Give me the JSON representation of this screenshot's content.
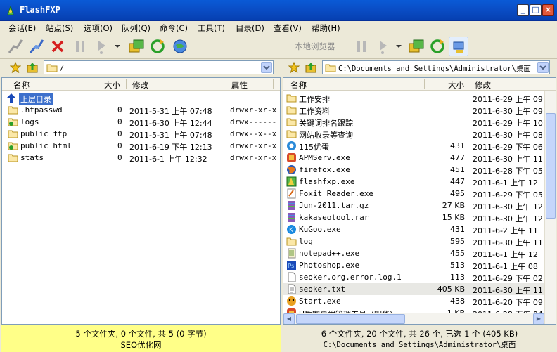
{
  "window": {
    "title": "FlashFXP",
    "min": "_",
    "max": "□",
    "close": "×"
  },
  "menu": [
    "会话(E)",
    "站点(S)",
    "选项(O)",
    "队列(Q)",
    "命令(C)",
    "工具(T)",
    "目录(D)",
    "查看(V)",
    "帮助(H)"
  ],
  "toolbar": {
    "local_browser_label": "本地浏览器"
  },
  "left": {
    "path": "/",
    "headers": {
      "name": "名称",
      "size": "大小",
      "modified": "修改",
      "attrs": "属性"
    },
    "up_label": "上层目录",
    "rows": [
      {
        "name": ".htpasswd",
        "size": "0",
        "date": "2011-5-31 上午 07:48",
        "attrs": "drwxr-xr-x",
        "icon": "folder"
      },
      {
        "name": "logs",
        "size": "0",
        "date": "2011-6-30 上午 12:44",
        "attrs": "drwx------",
        "icon": "folder-green"
      },
      {
        "name": "public_ftp",
        "size": "0",
        "date": "2011-5-31 上午 07:48",
        "attrs": "drwx--x--x",
        "icon": "folder"
      },
      {
        "name": "public_html",
        "size": "0",
        "date": "2011-6-19 下午 12:13",
        "attrs": "drwxr-xr-x",
        "icon": "folder-green"
      },
      {
        "name": "stats",
        "size": "0",
        "date": "2011-6-1 上午 12:32",
        "attrs": "drwxr-xr-x",
        "icon": "folder"
      }
    ],
    "status_line1": "5 个文件夹, 0 个文件, 共 5 (0 字节)",
    "status_line2": "SEO优化网"
  },
  "right": {
    "path": "C:\\Documents and Settings\\Administrator\\桌面",
    "headers": {
      "name": "名称",
      "size": "大小",
      "modified": "修改"
    },
    "rows": [
      {
        "name": "工作安排",
        "size": "",
        "date": "2011-6-29 上午 09",
        "icon": "folder"
      },
      {
        "name": "工作资料",
        "size": "",
        "date": "2011-6-30 上午 09",
        "icon": "folder"
      },
      {
        "name": "关键词排名跟踪",
        "size": "",
        "date": "2011-6-29 上午 10",
        "icon": "folder"
      },
      {
        "name": "网站收录等查询",
        "size": "",
        "date": "2011-6-30 上午 08",
        "icon": "folder"
      },
      {
        "name": "115优蛋",
        "size": "431",
        "date": "2011-6-29 下午 06",
        "icon": "app-blue"
      },
      {
        "name": "APMServ.exe",
        "size": "477",
        "date": "2011-6-30 上午 11",
        "icon": "app-red"
      },
      {
        "name": "firefox.exe",
        "size": "451",
        "date": "2011-6-28 下午 05",
        "icon": "firefox"
      },
      {
        "name": "flashfxp.exe",
        "size": "447",
        "date": "2011-6-1 上午 12",
        "icon": "flashfxp"
      },
      {
        "name": "Foxit Reader.exe",
        "size": "495",
        "date": "2011-6-29 下午 05",
        "icon": "foxit"
      },
      {
        "name": "Jun-2011.tar.gz",
        "size": "27 KB",
        "date": "2011-6-30 上午 12",
        "icon": "archive"
      },
      {
        "name": "kakaseotool.rar",
        "size": "15 KB",
        "date": "2011-6-30 上午 12",
        "icon": "archive"
      },
      {
        "name": "KuGoo.exe",
        "size": "431",
        "date": "2011-6-2 上午 11",
        "icon": "kugoo"
      },
      {
        "name": "log",
        "size": "595",
        "date": "2011-6-30 上午 11",
        "icon": "folder-doc"
      },
      {
        "name": "notepad++.exe",
        "size": "455",
        "date": "2011-6-1 上午 12",
        "icon": "notepad"
      },
      {
        "name": "Photoshop.exe",
        "size": "513",
        "date": "2011-6-1 上午 08",
        "icon": "photoshop"
      },
      {
        "name": "seoker.org.error.log.1",
        "size": "113",
        "date": "2011-6-29 下午 02",
        "icon": "file"
      },
      {
        "name": "seoker.txt",
        "size": "405 KB",
        "date": "2011-6-30 上午 11",
        "icon": "text",
        "selected": true
      },
      {
        "name": "Start.exe",
        "size": "438",
        "date": "2011-6-20 下午 09",
        "icon": "start"
      },
      {
        "name": "U盾客户端管理工具（明华）",
        "size": "1 KB",
        "date": "2011-6-28 下午 04",
        "icon": "app-red"
      }
    ],
    "status_line1": "6 个文件夹, 20 个文件, 共 26 个, 已选 1 个 (405 KB)",
    "status_line2": "C:\\Documents and Settings\\Administrator\\桌面"
  }
}
